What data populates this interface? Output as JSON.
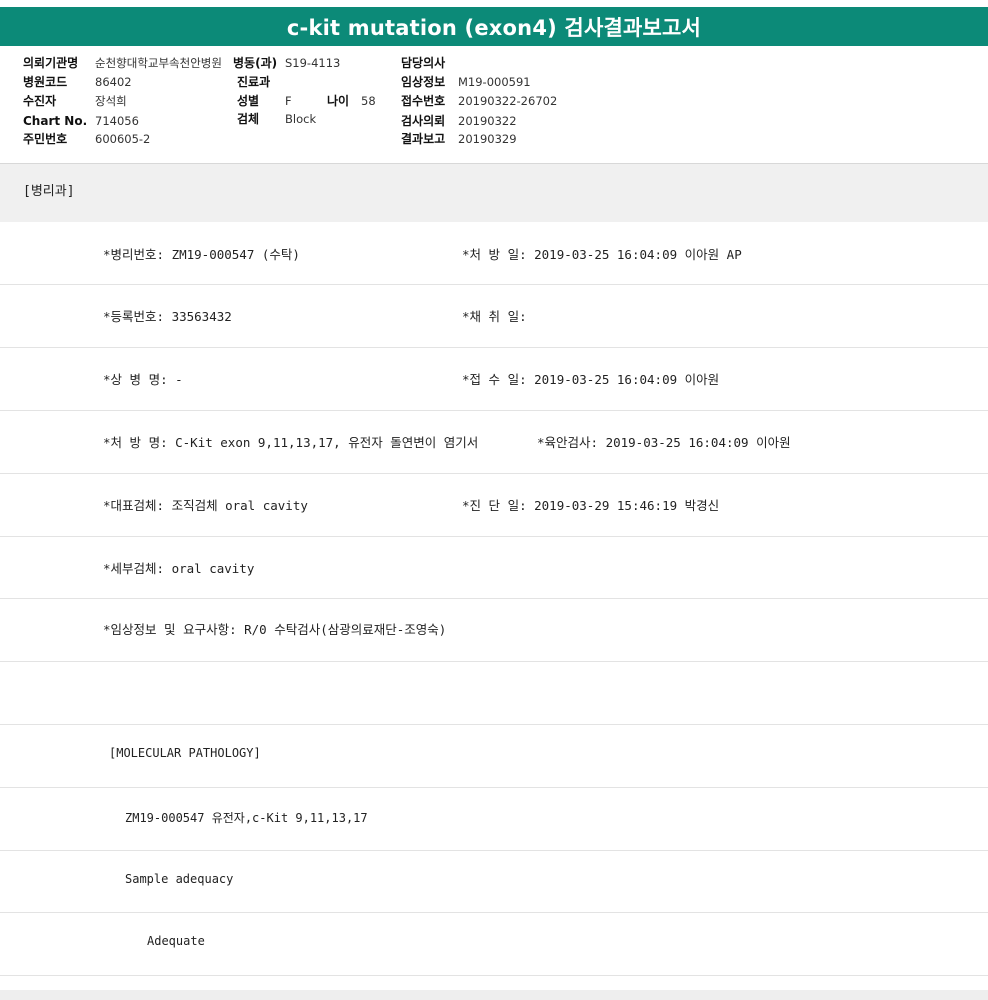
{
  "title": "c-kit mutation (exon4) 검사결과보고서",
  "header": {
    "labels": {
      "institution": "의뢰기관명",
      "hospital_code": "병원코드",
      "patient": "수진자",
      "chart_no": "Chart No.",
      "resident_no": "주민번호",
      "ward": "병동(과)",
      "department": "진료과",
      "sex": "성별",
      "age": "나이",
      "specimen": "검체",
      "doctor": "담당의사",
      "clinical_info": "임상정보",
      "accession_no": "접수번호",
      "request_date": "검사의뢰",
      "report_date": "결과보고"
    },
    "values": {
      "institution": "순천향대학교부속천안병원",
      "hospital_code": "86402",
      "patient": "장석희",
      "chart_no": "714056",
      "resident_no": "600605-2",
      "ward": "S19-4113",
      "department": "",
      "sex": "F",
      "age": "58",
      "specimen": "Block",
      "doctor": "",
      "clinical_info": "M19-000591",
      "accession_no": "20190322-26702",
      "request_date": "20190322",
      "report_date": "20190329"
    }
  },
  "department_section": "[병리과]",
  "rows": {
    "path_no": "*병리번호: ZM19-000547 (수탁)",
    "prescribe_date": "*처 방 일: 2019-03-25 16:04:09  이아원 AP",
    "reg_no": "*등록번호: 33563432",
    "collect_date": "*채 취 일:",
    "disease_name": "*상 병 명: -",
    "receipt_date": "*접 수 일: 2019-03-25 16:04:09  이아원",
    "order_name": "*처 방 명: C-Kit  exon 9,11,13,17, 유전자 돌연변이 염기서",
    "gross_exam": "*육안검사: 2019-03-25 16:04:09  이아원",
    "main_specimen": "*대표검체: 조직검체 oral cavity",
    "diagnosis_date": "*진 단 일: 2019-03-29 15:46:19  박경신",
    "sub_specimen": "*세부검체: oral cavity",
    "clinical_request": "*임상정보 및 요구사항: R/0 수탁검사(삼광의료재단-조영숙)"
  },
  "molecular": {
    "heading": "[MOLECULAR PATHOLOGY]",
    "case_line": "ZM19-000547    유전자,c-Kit 9,11,13,17",
    "adequacy_label": "Sample adequacy",
    "adequacy_value": "Adequate"
  }
}
